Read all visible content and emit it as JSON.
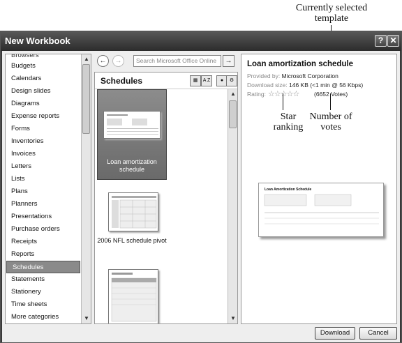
{
  "annotations": {
    "selected_template_line1": "Currently selected",
    "selected_template_line2": "template",
    "star_line1": "Star",
    "star_line2": "ranking",
    "votes_line1": "Number of",
    "votes_line2": "votes"
  },
  "window": {
    "title": "New Workbook",
    "help_glyph": "?",
    "close_glyph": "✕"
  },
  "categories": {
    "cut_item": "Browsers",
    "items": [
      "Budgets",
      "Calendars",
      "Design slides",
      "Diagrams",
      "Expense reports",
      "Forms",
      "Inventories",
      "Invoices",
      "Letters",
      "Lists",
      "Plans",
      "Planners",
      "Presentations",
      "Purchase orders",
      "Receipts",
      "Reports",
      "Schedules",
      "Statements",
      "Stationery",
      "Time sheets",
      "More categories"
    ],
    "selected": "Schedules"
  },
  "search": {
    "back_glyph": "←",
    "forward_glyph": "→",
    "placeholder": "Search Microsoft Office Online",
    "go_glyph": "→"
  },
  "middle": {
    "heading": "Schedules",
    "sort_label": "A Z",
    "templates": [
      {
        "label_line1": "Loan amortization",
        "label_line2": "schedule"
      },
      {
        "label_line1": "2006 NFL schedule pivot",
        "label_line2": ""
      },
      {
        "label_line1": "",
        "label_line2": ""
      }
    ]
  },
  "details": {
    "title": "Loan amortization schedule",
    "provided_by_label": "Provided by:",
    "provided_by_value": "Microsoft Corporation",
    "download_label": "Download size:",
    "download_value": "146 KB (<1 min @ 56 Kbps)",
    "rating_label": "Rating:",
    "stars_glyphs": "☆☆☆☆☆",
    "votes": "(6652 Votes)",
    "preview_heading": "Loan Amortization Schedule"
  },
  "buttons": {
    "download": "Download",
    "cancel": "Cancel"
  }
}
